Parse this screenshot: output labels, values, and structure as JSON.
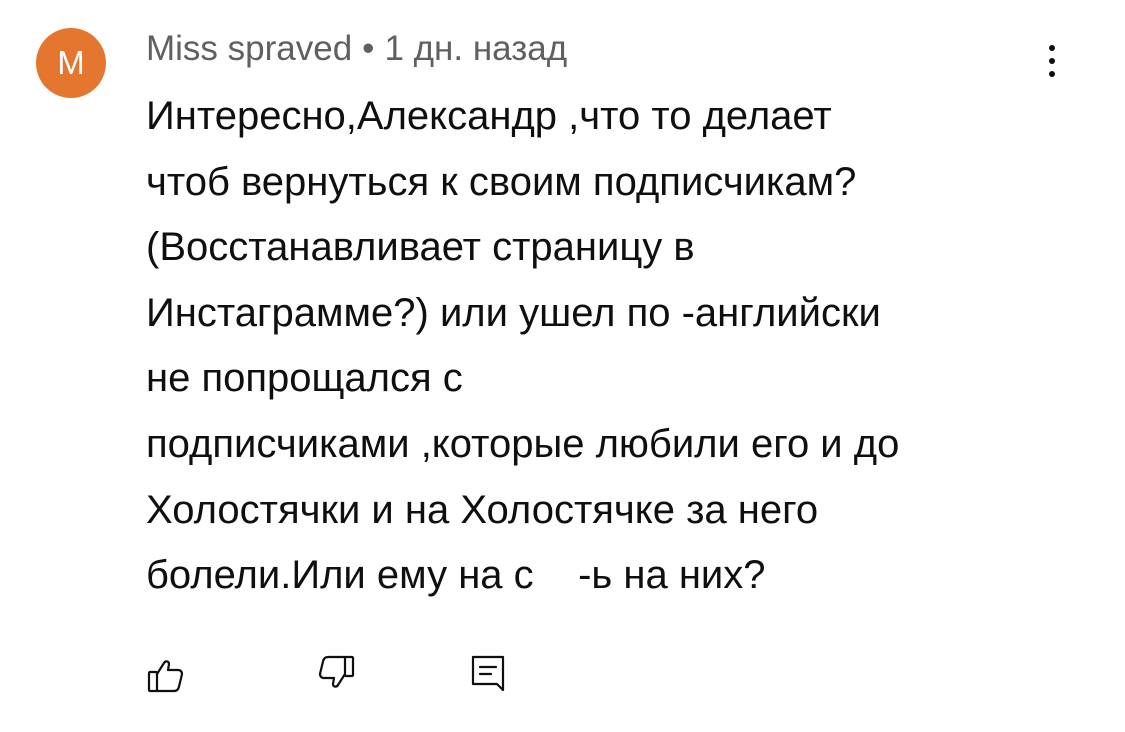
{
  "comment": {
    "avatar_letter": "M",
    "avatar_color": "#e5762f",
    "author": "Miss spraved",
    "separator": "•",
    "time": "1 дн. назад",
    "more_icon": "more-vertical-icon",
    "text_lines": [
      "Интересно,Александр ,что то делает",
      "чтоб вернуться к своим подписчикам?",
      "(Восстанавливает страницу в",
      "Инстаграмме?) или ушел по -английски",
      "не попрощался с",
      "подписчиками ,которые любили его и до",
      "Холостячки и на Холостячке за него",
      "болели.Или ему на с    -ь на них?"
    ],
    "actions": {
      "like_icon": "thumbs-up-icon",
      "dislike_icon": "thumbs-down-icon",
      "reply_icon": "reply-comment-icon"
    }
  }
}
